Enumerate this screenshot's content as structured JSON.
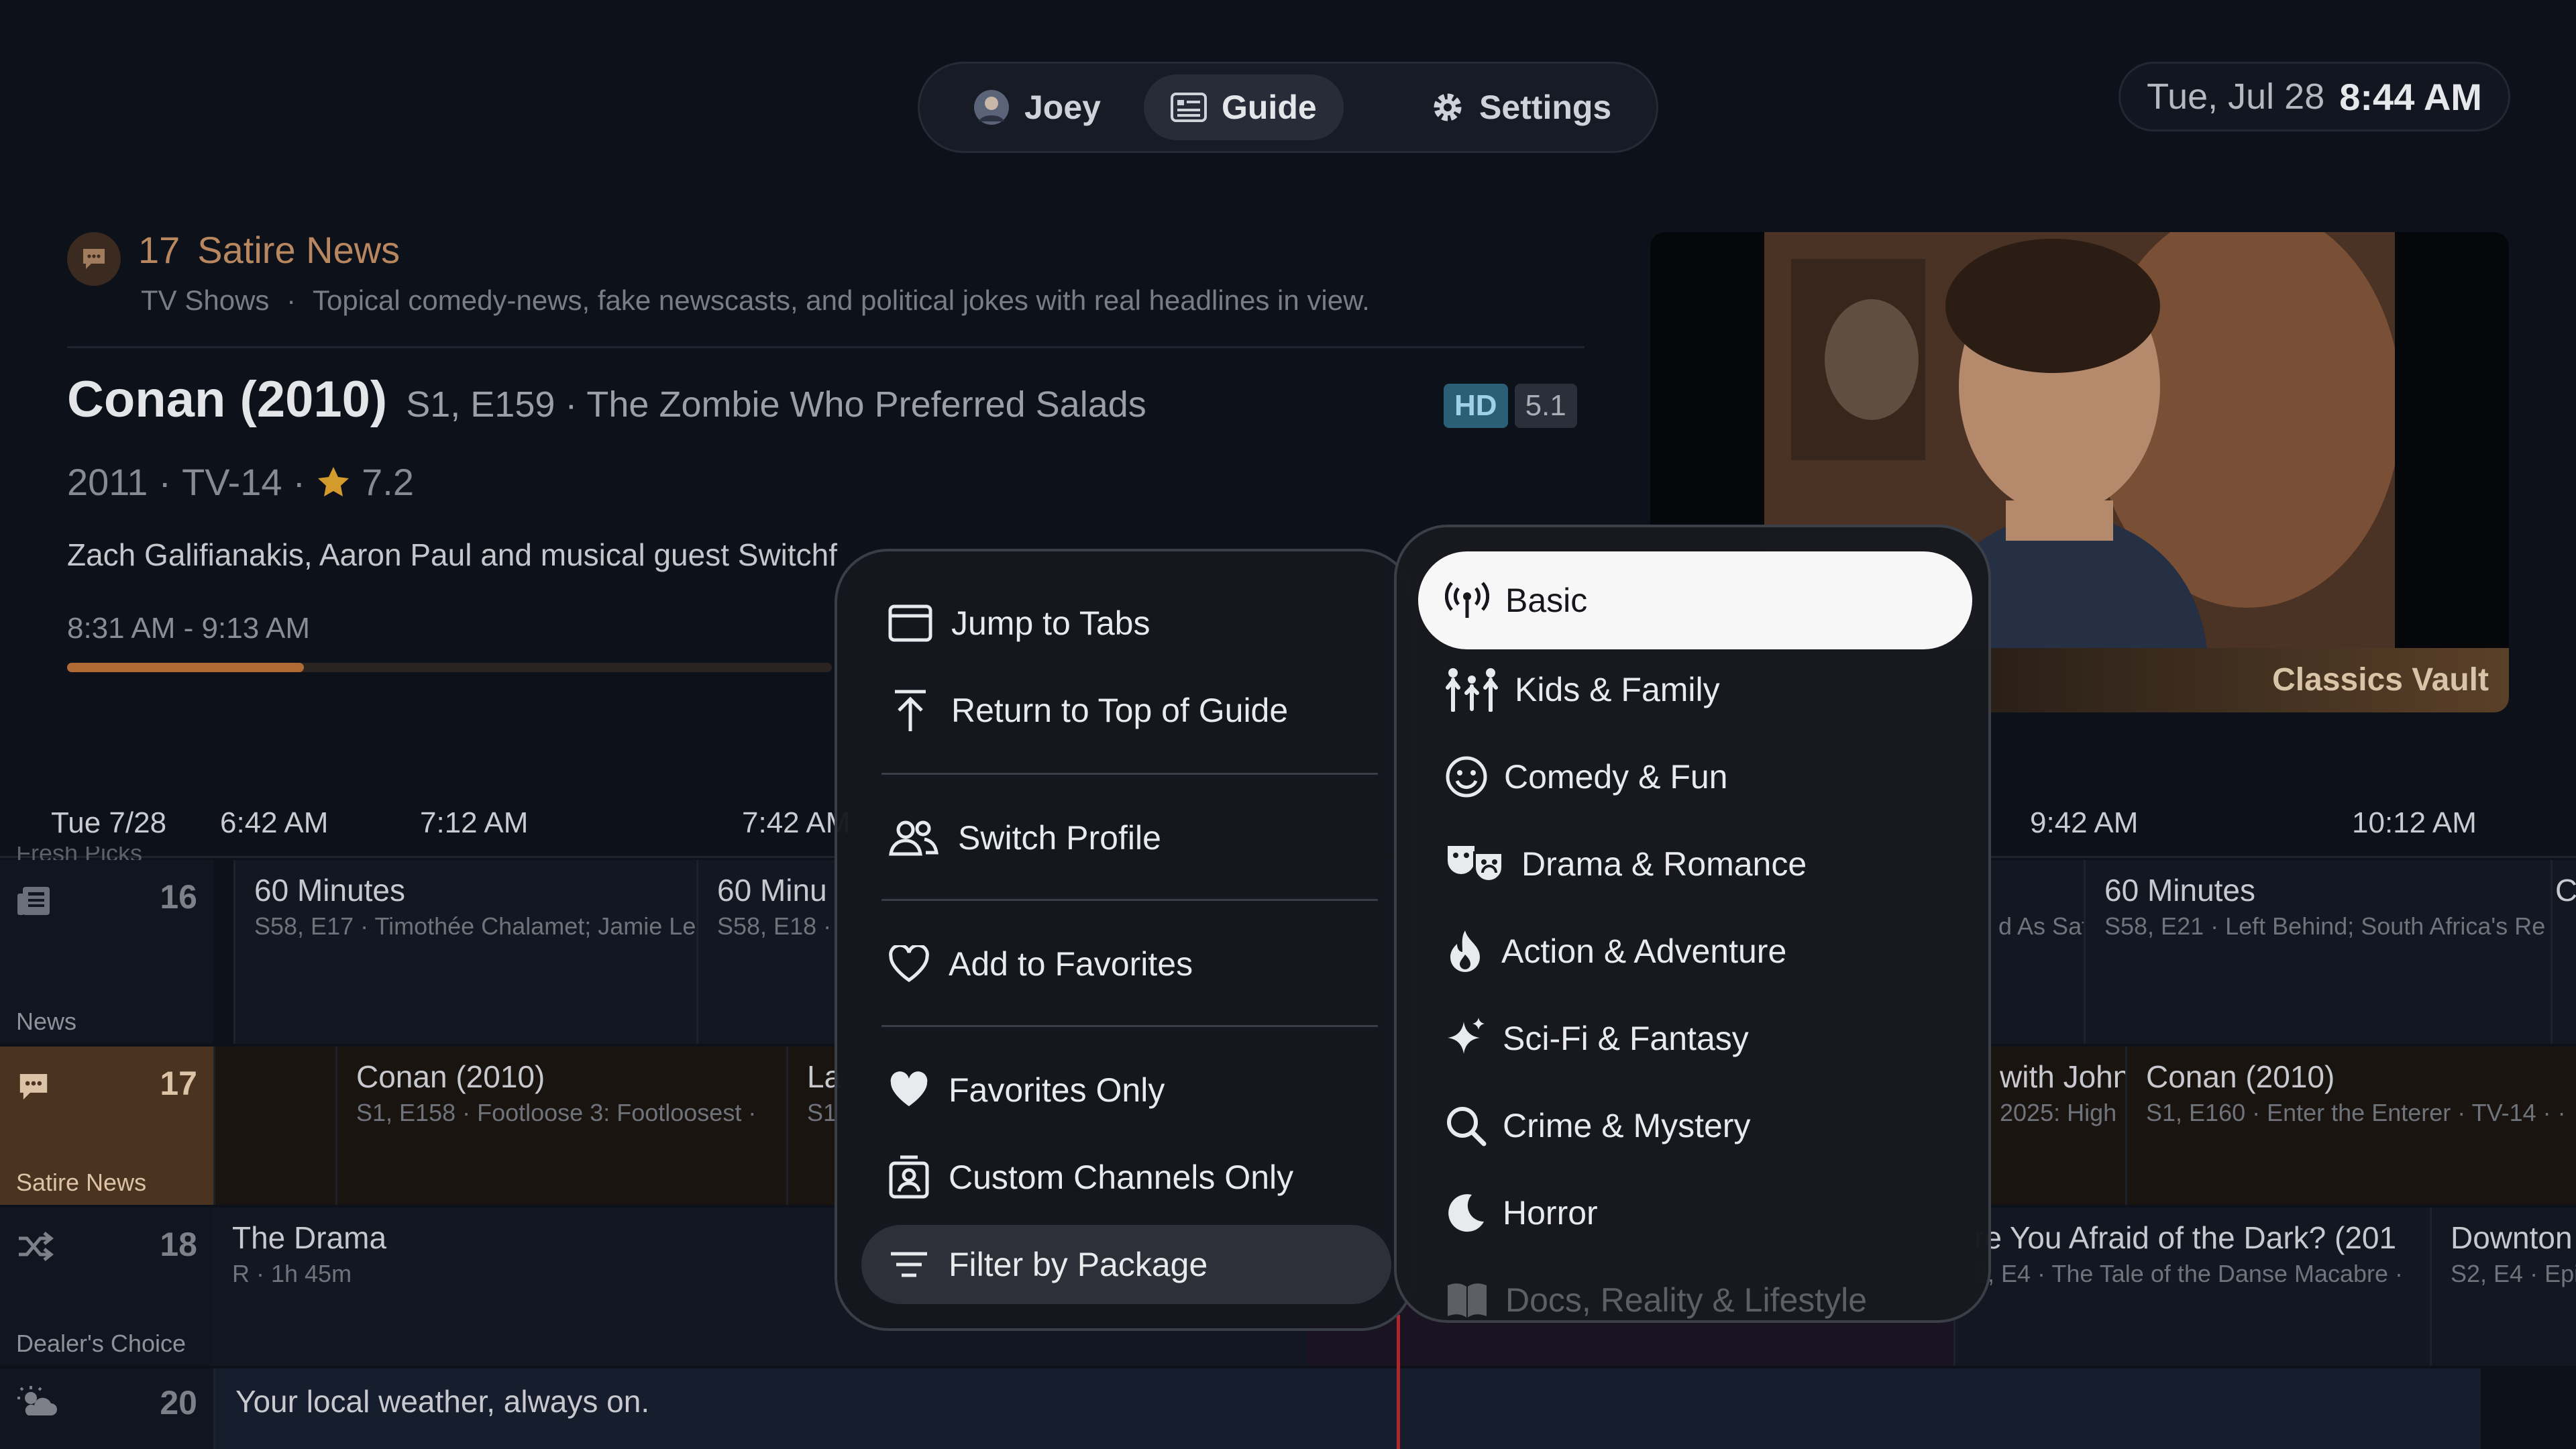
{
  "nav": {
    "profile_label": "Joey",
    "guide_label": "Guide",
    "settings_label": "Settings"
  },
  "clock": {
    "date": "Tue, Jul 28",
    "time": "8:44 AM"
  },
  "channel": {
    "number": "17",
    "name": "Satire News",
    "category": "TV Shows",
    "description": "Topical comedy-news, fake newscasts, and political jokes with real headlines in view."
  },
  "program": {
    "title": "Conan (2010)",
    "episode": "S1, E159 · The Zombie Who Preferred Salads",
    "badge_hd": "HD",
    "badge_audio": "5.1",
    "year": "2011",
    "rating": "TV-14",
    "score": "7.2",
    "cast": "Zach Galifianakis, Aaron Paul and musical guest Switchf",
    "time_range": "8:31 AM - 9:13 AM",
    "progress_fraction": 0.31
  },
  "preview": {
    "caption": "Classics Vault"
  },
  "timeline": {
    "date": "Tue 7/28",
    "slots": [
      "6:42 AM",
      "7:12 AM",
      "7:42 AM",
      "9:42 AM",
      "10:12 AM"
    ]
  },
  "guide": {
    "partial_group": "Fresh Picks",
    "rows": [
      {
        "number": "16",
        "group": "News",
        "icon": "newspaper-icon",
        "cells": [
          {
            "title": "60 Minutes",
            "sub": "S58, E17 · Timothée Chalamet; Jamie Le"
          },
          {
            "title": "60 Minu",
            "sub": "S58, E18 ·"
          },
          {
            "title": "",
            "sub": "d As Saf"
          },
          {
            "title": "60 Minutes",
            "sub": "S58, E21 · Left Behind; South Africa's Re"
          },
          {
            "title": "C",
            "sub": ""
          }
        ]
      },
      {
        "number": "17",
        "group": "Satire News",
        "icon": "speech-bubble-icon",
        "cells": [
          {
            "title": "",
            "sub": ""
          },
          {
            "title": "Conan (2010)",
            "sub": "S1, E158 · Footloose 3: Footloosest ·"
          },
          {
            "title": "La",
            "sub": "S1"
          },
          {
            "title": "with John",
            "sub": "2025: High"
          },
          {
            "title": "Conan (2010)",
            "sub": "S1, E160 · Enter the Enterer · TV-14 · ·"
          }
        ]
      },
      {
        "number": "18",
        "group": "Dealer's Choice",
        "icon": "shuffle-icon",
        "cells": [
          {
            "title": "The Drama",
            "sub": "R · 1h 45m"
          },
          {
            "title": "re You Afraid of the Dark? (201",
            "sub": "2, E4 · The Tale of the Danse Macabre ·"
          },
          {
            "title": "Downton",
            "sub": "S2, E4 · Epi"
          }
        ]
      },
      {
        "number": "20",
        "group": "",
        "icon": "weather-icon",
        "cells": [
          {
            "title": "Your local weather, always on.",
            "sub": ""
          }
        ]
      }
    ]
  },
  "menu": {
    "items": [
      {
        "label": "Jump to Tabs",
        "icon": "window-icon"
      },
      {
        "label": "Return to Top of Guide",
        "icon": "arrow-up-bar-icon"
      },
      {
        "label": "Switch Profile",
        "icon": "people-icon"
      },
      {
        "label": "Add to Favorites",
        "icon": "heart-outline-icon"
      },
      {
        "label": "Favorites Only",
        "icon": "heart-filled-icon"
      },
      {
        "label": "Custom Channels Only",
        "icon": "contact-card-icon"
      },
      {
        "label": "Filter by Package",
        "icon": "filter-lines-icon"
      }
    ]
  },
  "packages": {
    "items": [
      {
        "label": "Basic",
        "icon": "antenna-icon"
      },
      {
        "label": "Kids & Family",
        "icon": "family-icon"
      },
      {
        "label": "Comedy & Fun",
        "icon": "smiley-icon"
      },
      {
        "label": "Drama & Romance",
        "icon": "theater-masks-icon"
      },
      {
        "label": "Action & Adventure",
        "icon": "flame-icon"
      },
      {
        "label": "Sci-Fi & Fantasy",
        "icon": "sparkles-icon"
      },
      {
        "label": "Crime & Mystery",
        "icon": "magnifier-icon"
      },
      {
        "label": "Horror",
        "icon": "moon-icon"
      },
      {
        "label": "Docs, Reality & Lifestyle",
        "icon": "book-icon"
      }
    ]
  },
  "colors": {
    "accent_satire": "#b8875f",
    "progress": "#b06a34",
    "now_line": "#b0252c",
    "menu_selected": "#f7f7f8"
  }
}
